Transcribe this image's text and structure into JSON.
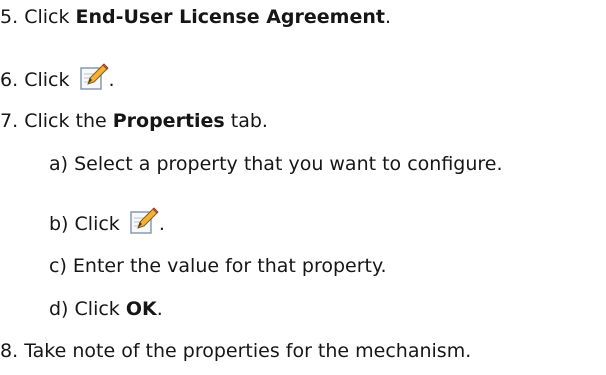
{
  "steps": [
    {
      "num": "5.",
      "pre": "Click ",
      "bold": "End-User License Agreement",
      "post": "."
    },
    {
      "num": "6.",
      "pre": "Click ",
      "post": ".",
      "icon": "edit-pencil-icon"
    },
    {
      "num": "7.",
      "pre": "Click the ",
      "bold": "Properties",
      "post": " tab."
    },
    {
      "num": "8.",
      "text": "Take note of the properties for the mechanism."
    }
  ],
  "substeps": [
    {
      "num": "a)",
      "text": "Select a property that you want to configure."
    },
    {
      "num": "b)",
      "pre": "Click ",
      "post": ".",
      "icon": "edit-pencil-icon"
    },
    {
      "num": "c)",
      "text": "Enter the value for that property."
    },
    {
      "num": "d)",
      "pre": "Click ",
      "bold": "OK",
      "post": "."
    }
  ]
}
